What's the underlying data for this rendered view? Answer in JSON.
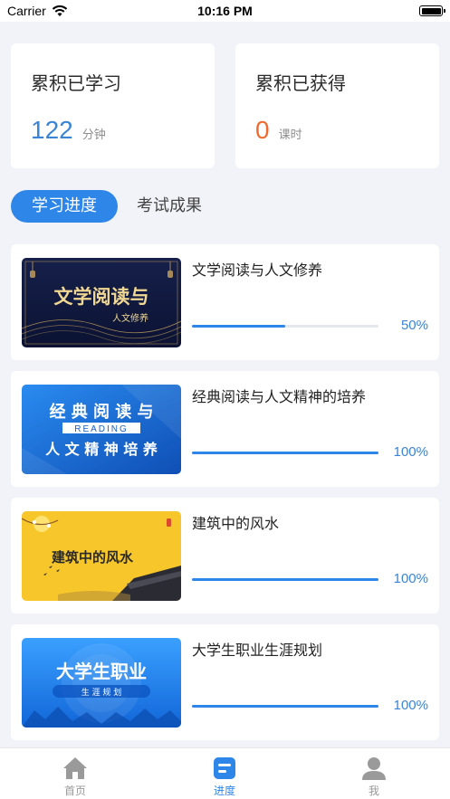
{
  "status_bar": {
    "carrier": "Carrier",
    "time": "10:16 PM"
  },
  "stats": [
    {
      "title": "累积已学习",
      "value": "122",
      "unit": "分钟",
      "color": "#3a84d6"
    },
    {
      "title": "累积已获得",
      "value": "0",
      "unit": "课时",
      "color": "#f06a2d"
    }
  ],
  "tabs": [
    {
      "label": "学习进度",
      "active": true
    },
    {
      "label": "考试成果",
      "active": false
    }
  ],
  "courses": [
    {
      "title": "文学阅读与人文修养",
      "progress": 0.5,
      "progress_label": "50%",
      "thumb_title": "文学阅读与",
      "thumb_subtitle": "人文修养"
    },
    {
      "title": "经典阅读与人文精神的培养",
      "progress": 1.0,
      "progress_label": "100%",
      "thumb_title": "经 典 阅 读 与",
      "thumb_badge": "READING",
      "thumb_subtitle": "人 文 精 神 培 养"
    },
    {
      "title": "建筑中的风水",
      "progress": 1.0,
      "progress_label": "100%",
      "thumb_title": "建筑中的风水"
    },
    {
      "title": "大学生职业生涯规划",
      "progress": 1.0,
      "progress_label": "100%",
      "thumb_title": "大学生职业",
      "thumb_subtitle": "生 涯 规 划"
    }
  ],
  "tabbar": [
    {
      "label": "首页",
      "icon": "home-icon",
      "active": false
    },
    {
      "label": "进度",
      "icon": "progress-icon",
      "active": true
    },
    {
      "label": "我",
      "icon": "profile-icon",
      "active": false
    }
  ],
  "colors": {
    "accent": "#2f86e9",
    "blue_value": "#3a84d6",
    "orange_value": "#f06a2d",
    "background": "#f1f3f8"
  }
}
